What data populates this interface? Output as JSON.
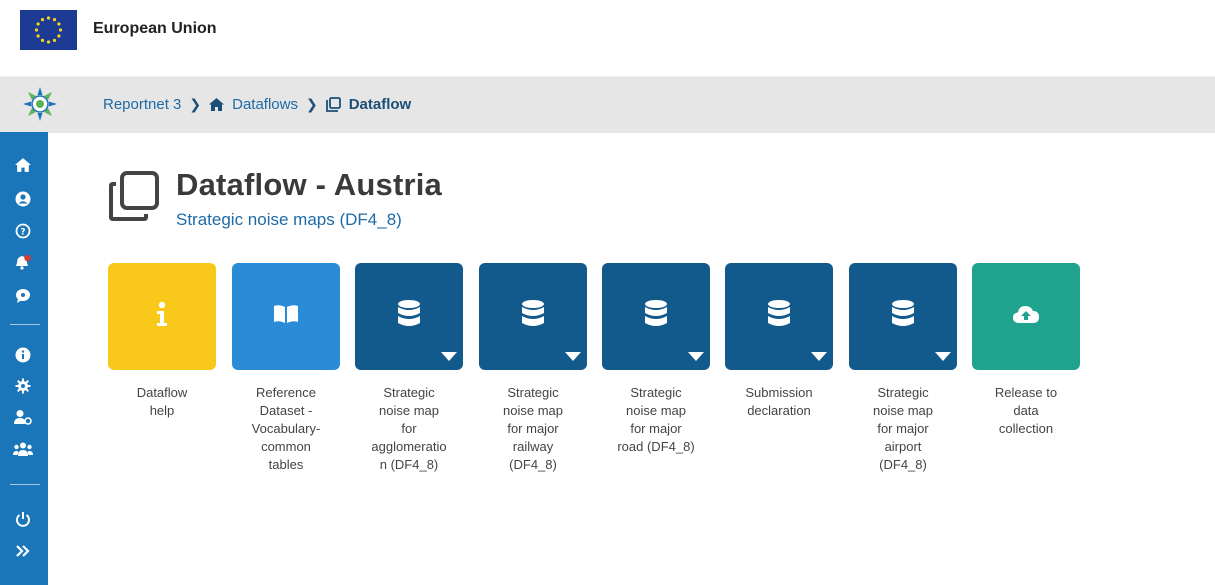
{
  "header": {
    "org_title": "European Union"
  },
  "breadcrumb": [
    {
      "label": "Reportnet 3",
      "icon": "none"
    },
    {
      "label": "Dataflows",
      "icon": "home-icon"
    },
    {
      "label": "Dataflow",
      "icon": "clone-icon"
    }
  ],
  "sidebar": {
    "items": [
      {
        "icon": "home-icon"
      },
      {
        "icon": "user-circle-icon"
      },
      {
        "icon": "help-circle-icon"
      },
      {
        "icon": "notification-bell-icon"
      },
      {
        "icon": "chat-bubble-icon"
      },
      {
        "icon": "info-icon"
      },
      {
        "icon": "settings-gear-icon"
      },
      {
        "icon": "user-settings-icon"
      },
      {
        "icon": "users-group-icon"
      },
      {
        "icon": "power-icon"
      },
      {
        "icon": "expand-chevrons-icon"
      }
    ]
  },
  "page": {
    "title": "Dataflow - Austria",
    "subtitle": "Strategic noise maps (DF4_8)"
  },
  "tiles": [
    {
      "label": "Dataflow help",
      "icon": "info-icon",
      "color": "#f8c91a",
      "dropdown": false
    },
    {
      "label": "Reference Dataset - Vocabulary-common tables",
      "icon": "book-open-icon",
      "color": "#2a8bd6",
      "dropdown": false
    },
    {
      "label": "Strategic noise map for agglomeration (DF4_8)",
      "icon": "database-icon",
      "color": "#135a8c",
      "dropdown": true
    },
    {
      "label": "Strategic noise map for major railway (DF4_8)",
      "icon": "database-icon",
      "color": "#135a8c",
      "dropdown": true
    },
    {
      "label": "Strategic noise map for major road (DF4_8)",
      "icon": "database-icon",
      "color": "#135a8c",
      "dropdown": true
    },
    {
      "label": "Submission declaration",
      "icon": "database-icon",
      "color": "#135a8c",
      "dropdown": true
    },
    {
      "label": "Strategic noise map for major airport (DF4_8)",
      "icon": "database-icon",
      "color": "#135a8c",
      "dropdown": true
    },
    {
      "label": "Release to data collection",
      "icon": "cloud-upload-icon",
      "color": "#20a38e",
      "dropdown": false
    }
  ],
  "tile_label_lines": [
    [
      "Dataflow",
      "help"
    ],
    [
      "Reference",
      "Dataset -",
      "Vocabulary-",
      "common",
      "tables"
    ],
    [
      "Strategic",
      "noise map",
      "for",
      "agglomeratio",
      "n (DF4_8)"
    ],
    [
      "Strategic",
      "noise map",
      "for major",
      "railway",
      "(DF4_8)"
    ],
    [
      "Strategic",
      "noise map",
      "for major",
      "road (DF4_8)"
    ],
    [
      "Submission",
      "declaration"
    ],
    [
      "Strategic",
      "noise map",
      "for major",
      "airport",
      "(DF4_8)"
    ],
    [
      "Release to",
      "data",
      "collection"
    ]
  ]
}
